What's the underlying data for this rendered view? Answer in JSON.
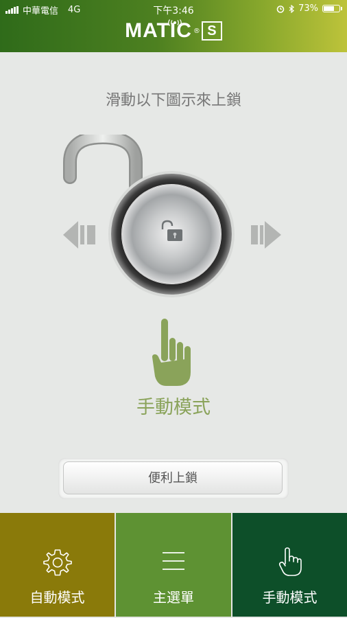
{
  "status_bar": {
    "carrier": "中華電信",
    "network": "4G",
    "time": "下午3:46",
    "battery": "73%",
    "battery_level": 0.73
  },
  "header": {
    "logo_text": "MATIC",
    "logo_reg": "®",
    "logo_badge": "S"
  },
  "main": {
    "instruction": "滑動以下圖示來上鎖",
    "mode_title": "手動模式",
    "quick_lock_label": "便利上鎖"
  },
  "tabs": [
    {
      "label": "自動模式",
      "icon": "gear-icon",
      "color": "#8a7a0a"
    },
    {
      "label": "主選單",
      "icon": "menu-icon",
      "color": "#5e9233"
    },
    {
      "label": "手動模式",
      "icon": "hand-pointer-icon",
      "color": "#0d4f29"
    }
  ],
  "colors": {
    "accent_green": "#8aa35a",
    "background": "#e6e8e6"
  }
}
